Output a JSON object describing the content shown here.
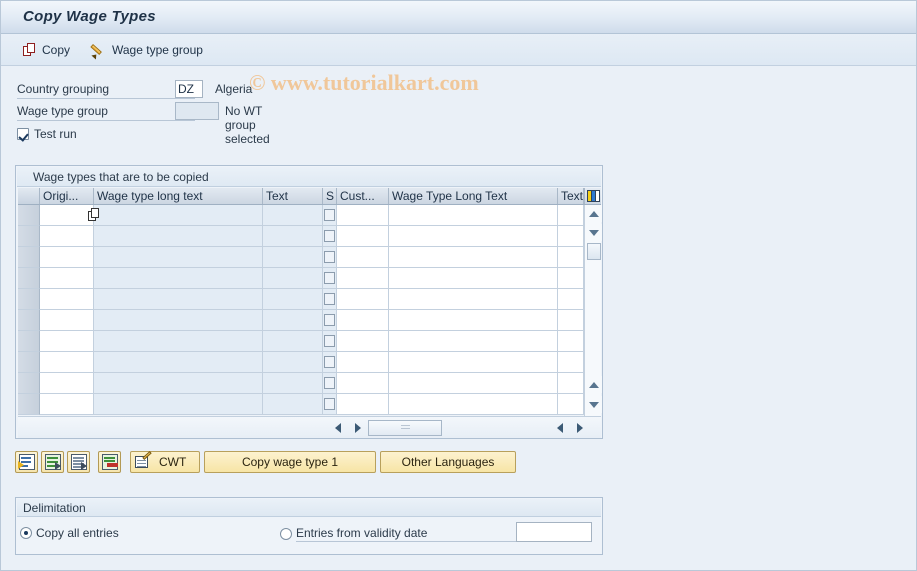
{
  "window": {
    "title": "Copy Wage Types",
    "watermark": "© www.tutorialkart.com"
  },
  "toolbar": {
    "copy_label": "Copy",
    "wage_type_group_label": "Wage type group"
  },
  "fields": {
    "country_grouping": {
      "label": "Country grouping",
      "value": "DZ",
      "description": "Algeria"
    },
    "wage_type_group": {
      "label": "Wage type group",
      "value": "",
      "description": "No WT group selected"
    },
    "test_run": {
      "label": "Test run",
      "checked": true
    }
  },
  "table": {
    "caption": "Wage types that are to be copied",
    "columns": [
      {
        "key": "rowhdr",
        "label": ""
      },
      {
        "key": "origin",
        "label": "Origi..."
      },
      {
        "key": "wt_long_text",
        "label": "Wage type long text"
      },
      {
        "key": "text1",
        "label": "Text"
      },
      {
        "key": "s",
        "label": "S"
      },
      {
        "key": "cust",
        "label": "Cust..."
      },
      {
        "key": "wt_long_text_2",
        "label": "Wage Type Long Text"
      },
      {
        "key": "text2",
        "label": "Text"
      }
    ],
    "config_icon": "table-settings-icon",
    "row_count": 10,
    "rows": [
      {
        "origin": "",
        "wt_long_text": "",
        "text1": "",
        "s": "",
        "cust": "",
        "wt_long_text_2": "",
        "text2": "",
        "has_matchcode": true
      },
      {
        "origin": "",
        "wt_long_text": "",
        "text1": "",
        "s": "",
        "cust": "",
        "wt_long_text_2": "",
        "text2": "",
        "has_matchcode": false
      },
      {
        "origin": "",
        "wt_long_text": "",
        "text1": "",
        "s": "",
        "cust": "",
        "wt_long_text_2": "",
        "text2": "",
        "has_matchcode": false
      },
      {
        "origin": "",
        "wt_long_text": "",
        "text1": "",
        "s": "",
        "cust": "",
        "wt_long_text_2": "",
        "text2": "",
        "has_matchcode": false
      },
      {
        "origin": "",
        "wt_long_text": "",
        "text1": "",
        "s": "",
        "cust": "",
        "wt_long_text_2": "",
        "text2": "",
        "has_matchcode": false
      },
      {
        "origin": "",
        "wt_long_text": "",
        "text1": "",
        "s": "",
        "cust": "",
        "wt_long_text_2": "",
        "text2": "",
        "has_matchcode": false
      },
      {
        "origin": "",
        "wt_long_text": "",
        "text1": "",
        "s": "",
        "cust": "",
        "wt_long_text_2": "",
        "text2": "",
        "has_matchcode": false
      },
      {
        "origin": "",
        "wt_long_text": "",
        "text1": "",
        "s": "",
        "cust": "",
        "wt_long_text_2": "",
        "text2": "",
        "has_matchcode": false
      },
      {
        "origin": "",
        "wt_long_text": "",
        "text1": "",
        "s": "",
        "cust": "",
        "wt_long_text_2": "",
        "text2": "",
        "has_matchcode": false
      },
      {
        "origin": "",
        "wt_long_text": "",
        "text1": "",
        "s": "",
        "cust": "",
        "wt_long_text_2": "",
        "text2": "",
        "has_matchcode": false
      }
    ]
  },
  "function_buttons": {
    "icons": [
      {
        "name": "copy-to-target-icon"
      },
      {
        "name": "copy-all-icon"
      },
      {
        "name": "copy-entries-icon"
      },
      {
        "name": "delete-entries-icon"
      }
    ],
    "cwt_label": "CWT",
    "copy_wage_type_label": "Copy wage type 1",
    "other_languages_label": "Other Languages"
  },
  "delimitation": {
    "caption": "Delimitation",
    "copy_all": {
      "label": "Copy all entries",
      "selected": true
    },
    "from_validity_date": {
      "label": "Entries from validity date",
      "selected": false
    },
    "validity_date_value": ""
  },
  "colors": {
    "accent": "#f5d016",
    "title_text": "#1f3247",
    "watermark": "#f0c79a",
    "button_yellow": "#f7e5a6",
    "panel_bg": "#eef3f9",
    "page_bg": "#eaf0f7"
  }
}
